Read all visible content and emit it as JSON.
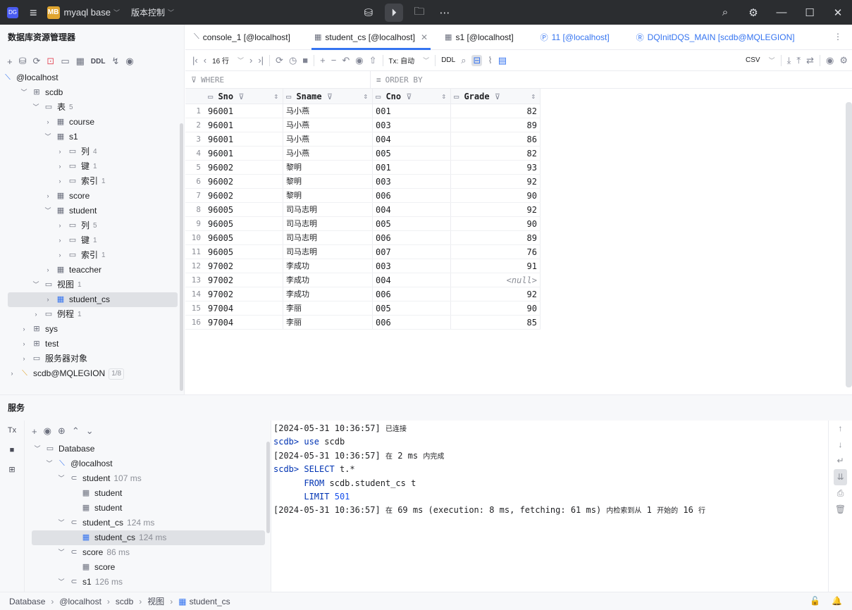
{
  "titlebar": {
    "app_icon": "DG",
    "project_badge": "MB",
    "project_name": "myaql base",
    "vcs_label": "版本控制",
    "center_icons": [
      "database-icon",
      "run-icon",
      "folder-icon",
      "more-icon"
    ],
    "right_icons": [
      "search-icon",
      "settings-icon",
      "minimize-icon",
      "maximize-icon",
      "close-icon"
    ]
  },
  "db_explorer": {
    "title": "数据库资源管理器",
    "toolbar_ddl": "DDL",
    "tree": [
      {
        "label": "@localhost",
        "count": "",
        "level": 0
      },
      {
        "label": "scdb",
        "count": "",
        "level": 1
      },
      {
        "label": "表",
        "count": "5",
        "level": 2
      },
      {
        "label": "course",
        "count": "",
        "level": 3
      },
      {
        "label": "s1",
        "count": "",
        "level": 3
      },
      {
        "label": "列",
        "count": "4",
        "level": 4
      },
      {
        "label": "键",
        "count": "1",
        "level": 4
      },
      {
        "label": "索引",
        "count": "1",
        "level": 4
      },
      {
        "label": "score",
        "count": "",
        "level": 3
      },
      {
        "label": "student",
        "count": "",
        "level": 3
      },
      {
        "label": "列",
        "count": "5",
        "level": 4
      },
      {
        "label": "键",
        "count": "1",
        "level": 4
      },
      {
        "label": "索引",
        "count": "1",
        "level": 4
      },
      {
        "label": "teaccher",
        "count": "",
        "level": 3
      },
      {
        "label": "视图",
        "count": "1",
        "level": 2
      },
      {
        "label": "student_cs",
        "count": "",
        "level": 3
      },
      {
        "label": "例程",
        "count": "1",
        "level": 2
      },
      {
        "label": "sys",
        "count": "",
        "level": 1
      },
      {
        "label": "test",
        "count": "",
        "level": 1
      },
      {
        "label": "服务器对象",
        "count": "",
        "level": 1
      },
      {
        "label": "scdb@MQLEGION",
        "count": "1/8",
        "level": 0
      }
    ]
  },
  "tabs": [
    {
      "label": "console_1 [@localhost]"
    },
    {
      "label": "student_cs [@localhost]"
    },
    {
      "label": "s1 [@localhost]"
    },
    {
      "label": "11 [@localhost]"
    },
    {
      "label": "DQInitDQS_MAIN [scdb@MQLEGION]"
    }
  ],
  "result_toolbar": {
    "rows_label": "16 行",
    "tx_label": "Tx: 自动",
    "ddl_label": "DDL",
    "export_format": "CSV"
  },
  "filter": {
    "where": "WHERE",
    "order_by": "ORDER BY"
  },
  "grid": {
    "columns": [
      "Sno",
      "Sname",
      "Cno",
      "Grade"
    ],
    "rows": [
      [
        "1",
        "96001",
        "马小燕",
        "001",
        "82"
      ],
      [
        "2",
        "96001",
        "马小燕",
        "003",
        "89"
      ],
      [
        "3",
        "96001",
        "马小燕",
        "004",
        "86"
      ],
      [
        "4",
        "96001",
        "马小燕",
        "005",
        "82"
      ],
      [
        "5",
        "96002",
        "黎明",
        "001",
        "93"
      ],
      [
        "6",
        "96002",
        "黎明",
        "003",
        "92"
      ],
      [
        "7",
        "96002",
        "黎明",
        "006",
        "90"
      ],
      [
        "8",
        "96005",
        "司马志明",
        "004",
        "92"
      ],
      [
        "9",
        "96005",
        "司马志明",
        "005",
        "90"
      ],
      [
        "10",
        "96005",
        "司马志明",
        "006",
        "89"
      ],
      [
        "11",
        "96005",
        "司马志明",
        "007",
        "76"
      ],
      [
        "12",
        "97002",
        "李成功",
        "003",
        "91"
      ],
      [
        "13",
        "97002",
        "李成功",
        "004",
        "<null>"
      ],
      [
        "14",
        "97002",
        "李成功",
        "006",
        "92"
      ],
      [
        "15",
        "97004",
        "李丽",
        "005",
        "90"
      ],
      [
        "16",
        "97004",
        "李丽",
        "006",
        "85"
      ]
    ]
  },
  "services": {
    "title": "服务",
    "side_tx": "Tx",
    "tree": [
      {
        "label": "Database",
        "time": "",
        "level": 0
      },
      {
        "label": "@localhost",
        "time": "",
        "level": 1
      },
      {
        "label": "student",
        "time": "107 ms",
        "level": 2
      },
      {
        "label": "student",
        "time": "",
        "level": 3
      },
      {
        "label": "student",
        "time": "",
        "level": 3
      },
      {
        "label": "student_cs",
        "time": "124 ms",
        "level": 2
      },
      {
        "label": "student_cs",
        "time": "124 ms",
        "level": 3
      },
      {
        "label": "score",
        "time": "86 ms",
        "level": 2
      },
      {
        "label": "score",
        "time": "",
        "level": 3
      },
      {
        "label": "s1",
        "time": "126 ms",
        "level": 2
      }
    ],
    "console": {
      "l1_ts": "[2024-05-31 10:36:57]",
      "l1_msg": "已连接",
      "l2_prompt": "scdb>",
      "l2_kw": "use",
      "l2_rest": "scdb",
      "l3_ts": "[2024-05-31 10:36:57]",
      "l3_a": "在",
      "l3_num": "2 ms",
      "l3_b": "内完成",
      "l4_prompt": "scdb>",
      "l4_kw": "SELECT",
      "l4_rest": "t.*",
      "l5_kw": "FROM",
      "l5_rest": "scdb.student_cs t",
      "l6_kw": "LIMIT",
      "l6_num": "501",
      "l7_ts": "[2024-05-31 10:36:57]",
      "l7_a": "在",
      "l7_b": "69 ms (execution: 8 ms, fetching: 61 ms)",
      "l7_c": "内检索到从",
      "l7_d": "1",
      "l7_e": "开始的",
      "l7_f": "16",
      "l7_g": "行"
    }
  },
  "statusbar": {
    "crumbs": [
      "Database",
      "@localhost",
      "scdb",
      "视图",
      "student_cs"
    ]
  }
}
